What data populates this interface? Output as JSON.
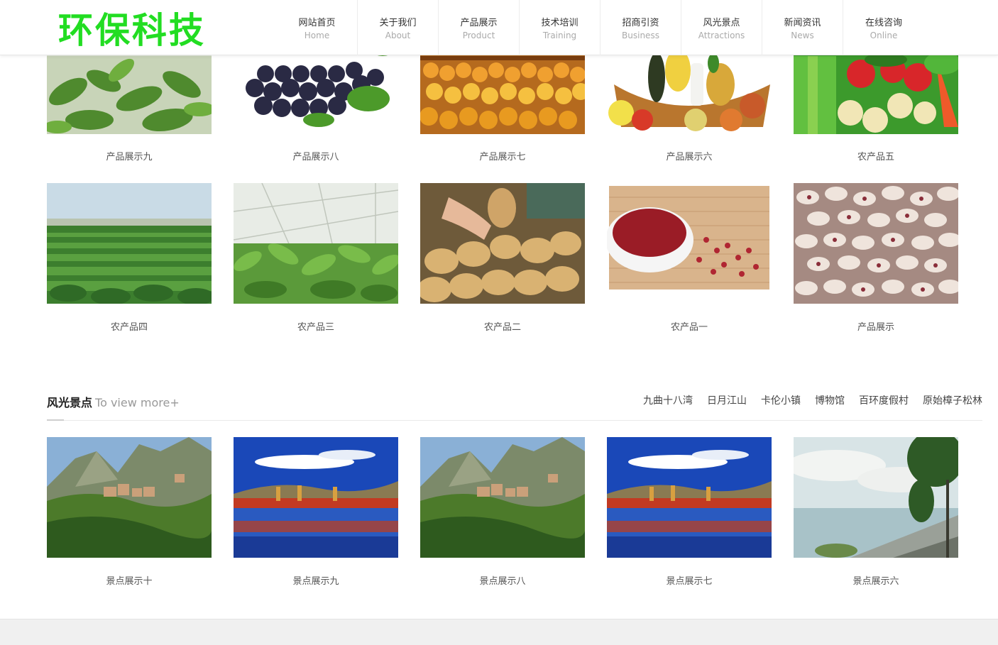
{
  "header": {
    "logo_text": "环保科技",
    "nav": [
      {
        "cn": "网站首页",
        "en": "Home"
      },
      {
        "cn": "关于我们",
        "en": "About"
      },
      {
        "cn": "产品展示",
        "en": "Product"
      },
      {
        "cn": "技术培训",
        "en": "Training"
      },
      {
        "cn": "招商引资",
        "en": "Business"
      },
      {
        "cn": "风光景点",
        "en": "Attractions"
      },
      {
        "cn": "新闻资讯",
        "en": "News"
      },
      {
        "cn": "在线咨询",
        "en": "Online"
      }
    ]
  },
  "products_row1": [
    "产品展示九",
    "产品展示八",
    "产品展示七",
    "产品展示六",
    "农产品五"
  ],
  "products_row2": [
    "农产品四",
    "农产品三",
    "农产品二",
    "农产品一",
    "产品展示"
  ],
  "attractions_section": {
    "title_cn": "风光景点",
    "title_en": "To view more+",
    "links": [
      "九曲十八湾",
      "日月江山",
      "卡伦小镇",
      "博物馆",
      "百环度假村",
      "原始樟子松林"
    ],
    "items": [
      "景点展示十",
      "景点展示九",
      "景点展示八",
      "景点展示七",
      "景点展示六"
    ]
  },
  "colors": {
    "logo_green": "#22dd22",
    "footer_gray": "#f0f0f0"
  }
}
